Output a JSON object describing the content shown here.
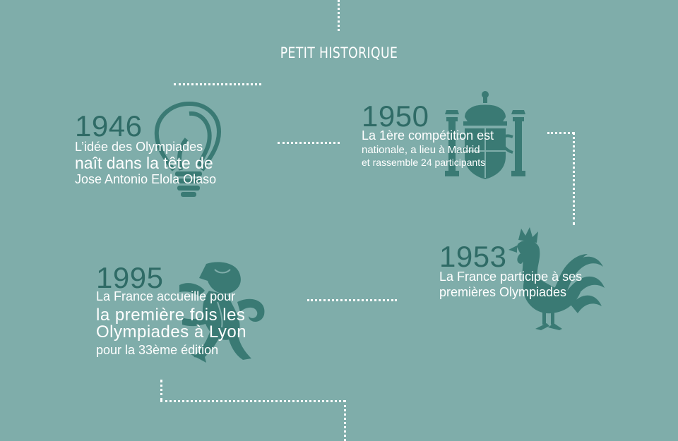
{
  "title": "PETIT HISTORIQUE",
  "colors": {
    "background": "#7fadaa",
    "year": "#2f6b66",
    "emblem": "#3a7a74",
    "text": "#ffffff",
    "dots": "#ffffff"
  },
  "events": [
    {
      "year": "1946",
      "icon": "lightbulb-icon",
      "lines": [
        "L’idée des Olympiades",
        "naît dans la tête de",
        "Jose Antonio Elola Olaso"
      ]
    },
    {
      "year": "1950",
      "icon": "spanish-coat-of-arms-icon",
      "lines": [
        "La 1ère compétition est",
        "nationale, a lieu à Madrid",
        "et rassemble 24 participants"
      ]
    },
    {
      "year": "1953",
      "icon": "gallic-rooster-icon",
      "lines": [
        "La France participe à ses",
        "premières Olympiades"
      ]
    },
    {
      "year": "1995",
      "icon": "lion-icon",
      "lines": [
        "La France accueille pour",
        "la première fois les",
        "Olympiades à Lyon",
        "pour la 33ème édition"
      ]
    }
  ]
}
